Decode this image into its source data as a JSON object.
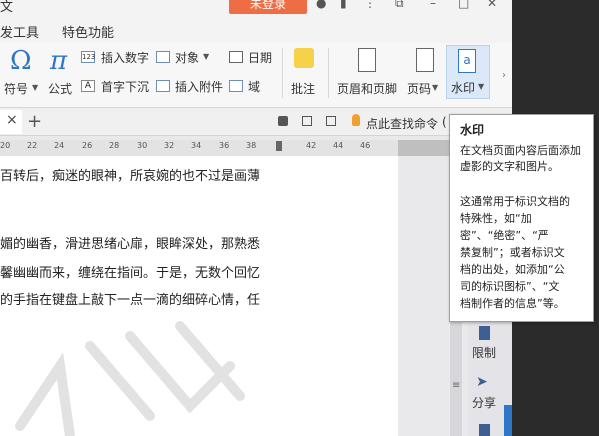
{
  "titlebar": {
    "title_fragment": "文",
    "login_label": "未登录"
  },
  "menu": {
    "tabs": [
      "发工具",
      "特色功能"
    ]
  },
  "ribbon": {
    "symbol_label": "符号",
    "formula_label": "公式",
    "insert_number_label": "插入数字",
    "object_label": "对象",
    "date_label": "日期",
    "drop_cap_label": "首字下沉",
    "insert_attachment_label": "插入附件",
    "field_label": "域",
    "comment_label": "批注",
    "header_footer_label": "页眉和页脚",
    "page_number_label": "页码",
    "watermark_label": "水印"
  },
  "tabrow": {
    "search_label": "点此查找命令",
    "paren": "("
  },
  "ruler": {
    "ticks": [
      "20",
      "22",
      "24",
      "26",
      "28",
      "30",
      "32",
      "34",
      "36",
      "38",
      "",
      "42",
      "44",
      "46"
    ]
  },
  "document": {
    "lines": [
      "百转后，痴迷的眼神，所哀婉的也不过是画薄",
      "媚的幽香，滑进思绪心扉，眼眸深处，那熟悉",
      "馨幽幽而来，缠绕在指间。于是，无数个回忆",
      "的手指在键盘上敲下一点一滴的细碎心情，任"
    ]
  },
  "rightpane": {
    "restrict_label": "限制",
    "share_label": "分享"
  },
  "tooltip": {
    "title": "水印",
    "p1": "在文档页面内容后面添加虚影的文字和图片。",
    "p2_lines": [
      "这通常用于标识文档的",
      "特殊性，如“加",
      "密”、“绝密”、“严",
      "禁复制”；或者标识文",
      "档的出处，如添加“公",
      "司的标识图标”、“文",
      "档制作者的信息”等。"
    ]
  },
  "colors": {
    "accent": "#2f75c8",
    "login": "#ee6d45"
  }
}
